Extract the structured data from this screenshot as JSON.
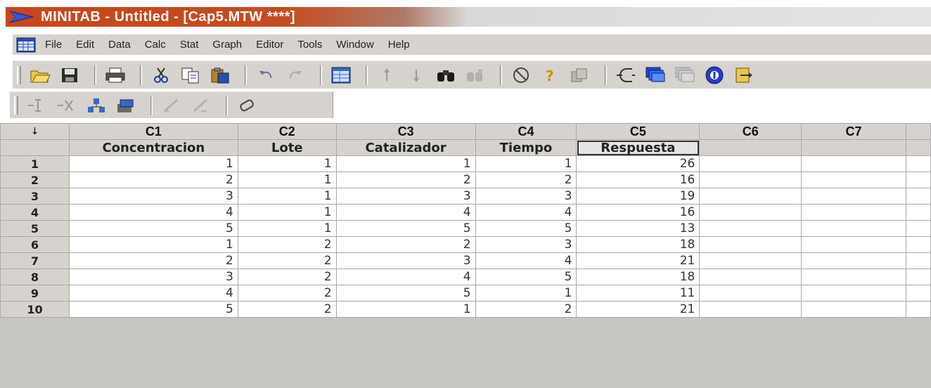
{
  "window": {
    "title": "MINITAB - Untitled - [Cap5.MTW ****]"
  },
  "menu": [
    "File",
    "Edit",
    "Data",
    "Calc",
    "Stat",
    "Graph",
    "Editor",
    "Tools",
    "Window",
    "Help"
  ],
  "toolbar1": [
    "open-icon",
    "save-icon",
    "print-icon",
    "cut-icon",
    "copy-icon",
    "paste-icon",
    "undo-icon",
    "redo-icon",
    "worksheet-icon",
    "up-arrow-icon",
    "down-arrow-icon",
    "find-icon",
    "replace-icon",
    "cancel-icon",
    "help-icon",
    "session-icon",
    "graph-icon",
    "layer-icon",
    "layer-gray-icon",
    "info-icon",
    "exit-icon"
  ],
  "toolbar2": [
    "insert-row-icon",
    "delete-row-icon",
    "insert-column-icon",
    "move-column-icon",
    "edit-icon",
    "edit-gray-icon",
    "eraser-icon"
  ],
  "worksheet": {
    "corner_label": "↓",
    "columns": [
      "C1",
      "C2",
      "C3",
      "C4",
      "C5",
      "C6",
      "C7"
    ],
    "names": [
      "Concentracion",
      "Lote",
      "Catalizador",
      "Tiempo",
      "Respuesta",
      "",
      ""
    ],
    "rows": [
      {
        "num": "1",
        "values": [
          "1",
          "1",
          "1",
          "1",
          "26"
        ]
      },
      {
        "num": "2",
        "values": [
          "2",
          "1",
          "2",
          "2",
          "16"
        ]
      },
      {
        "num": "3",
        "values": [
          "3",
          "1",
          "3",
          "3",
          "19"
        ]
      },
      {
        "num": "4",
        "values": [
          "4",
          "1",
          "4",
          "4",
          "16"
        ]
      },
      {
        "num": "5",
        "values": [
          "5",
          "1",
          "5",
          "5",
          "13"
        ]
      },
      {
        "num": "6",
        "values": [
          "1",
          "2",
          "2",
          "3",
          "18"
        ]
      },
      {
        "num": "7",
        "values": [
          "2",
          "2",
          "3",
          "4",
          "21"
        ]
      },
      {
        "num": "8",
        "values": [
          "3",
          "2",
          "4",
          "5",
          "18"
        ]
      },
      {
        "num": "9",
        "values": [
          "4",
          "2",
          "5",
          "1",
          "11"
        ]
      },
      {
        "num": "10",
        "values": [
          "5",
          "2",
          "1",
          "2",
          "21"
        ]
      }
    ]
  },
  "colors": {
    "titlebar": "#c8461b",
    "chrome": "#d6d3ce",
    "grid_line": "#a8a8a8"
  }
}
